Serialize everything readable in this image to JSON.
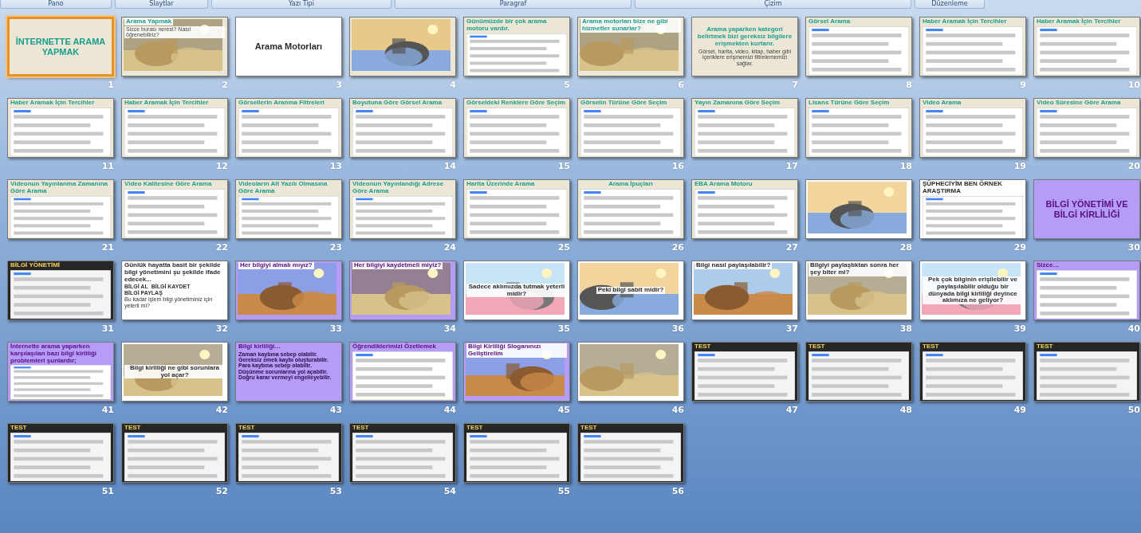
{
  "ribbon_groups": [
    {
      "label": "Pano"
    },
    {
      "label": "Slaytlar"
    },
    {
      "label": "Yazı Tipi"
    },
    {
      "label": "Paragraf"
    },
    {
      "label": "Çizim"
    },
    {
      "label": "Düzenleme"
    }
  ],
  "slides": [
    {
      "number": "1",
      "kind": "beige",
      "centered": true,
      "title": "İNTERNETTE ARAMA YAPMAK",
      "selected": true
    },
    {
      "number": "2",
      "kind": "beige",
      "centered": false,
      "title": "Arama Yapmak",
      "caption": "Sizce burası neresi? Nasıl öğrenebiliriz?",
      "selected": false
    },
    {
      "number": "3",
      "kind": "white",
      "centered": true,
      "title": "Arama Motorları",
      "selected": false
    },
    {
      "number": "4",
      "kind": "beige",
      "selected": false
    },
    {
      "number": "5",
      "kind": "beige",
      "centered": false,
      "title": "Günümüzde bir çok arama motoru vardır.",
      "media": {
        "kind": "panel"
      },
      "selected": false
    },
    {
      "number": "6",
      "kind": "beige",
      "centered": false,
      "title": "Arama motorları bize ne gibi hizmetler sunarlar?",
      "selected": false
    },
    {
      "number": "7",
      "kind": "beige",
      "centered": true,
      "title": "Arama yaparken kategori belirtmek bizi gereksiz bilgilere erişmekten kurtarır.",
      "caption": "Görsel, harita, video, kitap, haber gibi içeriklere erişmemizi filtrelememizi sağlar.",
      "selected": false
    },
    {
      "number": "8",
      "kind": "beige",
      "centered": false,
      "title": "Görsel Arama",
      "media": {
        "kind": "panel"
      },
      "selected": false
    },
    {
      "number": "9",
      "kind": "beige",
      "centered": false,
      "title": "Haber Aramak İçin Tercihler",
      "media": {
        "kind": "panel"
      },
      "selected": false
    },
    {
      "number": "10",
      "kind": "beige",
      "centered": false,
      "title": "Haber Aramak İçin Tercihler",
      "media": {
        "kind": "panel"
      },
      "selected": false
    },
    {
      "number": "11",
      "kind": "beige",
      "centered": false,
      "title": "Haber Aramak İçin Tercihler",
      "media": {
        "kind": "panel"
      },
      "selected": false
    },
    {
      "number": "12",
      "kind": "beige",
      "centered": false,
      "title": "Haber Aramak İçin Tercihler",
      "media": {
        "kind": "panel"
      },
      "selected": false
    },
    {
      "number": "13",
      "kind": "beige",
      "centered": false,
      "title": "Görsellerin Aranma Filtreleri",
      "media": {
        "kind": "panel"
      },
      "selected": false
    },
    {
      "number": "14",
      "kind": "beige",
      "centered": false,
      "title": "Boyutuna Göre Görsel Arama",
      "media": {
        "kind": "panel"
      },
      "selected": false
    },
    {
      "number": "15",
      "kind": "beige",
      "centered": false,
      "title": "Görseldeki Renklere Göre Seçim",
      "media": {
        "kind": "panel"
      },
      "selected": false
    },
    {
      "number": "16",
      "kind": "beige",
      "centered": false,
      "title": "Görselin Türüne Göre Seçim",
      "media": {
        "kind": "panel"
      },
      "selected": false
    },
    {
      "number": "17",
      "kind": "beige",
      "centered": false,
      "title": "Yayın Zamanına Göre Seçim",
      "media": {
        "kind": "panel"
      },
      "selected": false
    },
    {
      "number": "18",
      "kind": "beige",
      "centered": false,
      "title": "Lisans Türüne Göre Seçim",
      "media": {
        "kind": "panel"
      },
      "selected": false
    },
    {
      "number": "19",
      "kind": "beige",
      "centered": false,
      "title": "Video Arama",
      "media": {
        "kind": "panel"
      },
      "selected": false
    },
    {
      "number": "20",
      "kind": "beige",
      "centered": false,
      "title": "Video Süresine Göre Arama",
      "media": {
        "kind": "panel"
      },
      "selected": false
    },
    {
      "number": "21",
      "kind": "beige",
      "centered": false,
      "title": "Videonun Yayınlanma Zamanına Göre Arama",
      "media": {
        "kind": "panel"
      },
      "selected": false
    },
    {
      "number": "22",
      "kind": "beige",
      "centered": false,
      "title": "Video Kalitesine Göre Arama",
      "media": {
        "kind": "panel"
      },
      "selected": false
    },
    {
      "number": "23",
      "kind": "beige",
      "centered": false,
      "title": "Videoların Alt Yazılı Olmasına Göre Arama",
      "media": {
        "kind": "panel"
      },
      "selected": false
    },
    {
      "number": "24",
      "kind": "beige",
      "centered": false,
      "title": "Videonun Yayınlandığı Adrese Göre Arama",
      "media": {
        "kind": "panel"
      },
      "selected": false
    },
    {
      "number": "25",
      "kind": "beige",
      "centered": false,
      "title": "Harita Üzerinde Arama",
      "media": {
        "kind": "panel"
      },
      "selected": false
    },
    {
      "number": "26",
      "kind": "beige",
      "centered": true,
      "title": "Arama İpuçları",
      "media": {
        "kind": "panel"
      },
      "selected": false
    },
    {
      "number": "27",
      "kind": "beige",
      "centered": false,
      "title": "EBA Arama Motoru",
      "media": {
        "kind": "panel"
      },
      "selected": false
    },
    {
      "number": "28",
      "kind": "white",
      "selected": false
    },
    {
      "number": "29",
      "kind": "white",
      "centered": false,
      "title": "ŞÜPHECİYİM BEN ÖRNEK ARAŞTIRMA",
      "media": {
        "kind": "panel"
      },
      "selected": false
    },
    {
      "number": "30",
      "kind": "purple",
      "centered": true,
      "title": "BİLGİ YÖNETİMİ VE BİLGİ KİRLİLİĞİ",
      "selected": false
    },
    {
      "number": "31",
      "kind": "dark",
      "centered": false,
      "title": "BİLGİ YÖNETİMİ",
      "media": {
        "kind": "panel"
      },
      "selected": false
    },
    {
      "number": "32",
      "kind": "white",
      "centered": false,
      "title": "Günlük hayatta basit bir şekilde bilgi yönetimini şu şekilde ifade edecek...",
      "bullets": [
        "BİLGİ AL",
        "BİLGİ KAYDET",
        "BİLGİ PAYLAŞ"
      ],
      "caption": "Bu kadar işlem bilgi yönetiminiz için yeterli mi?",
      "selected": false
    },
    {
      "number": "33",
      "kind": "purple",
      "centered": false,
      "title": "Her bilgiyi almalı mıyız?",
      "selected": false
    },
    {
      "number": "34",
      "kind": "purple",
      "centered": false,
      "title": "Her bilgiyi kaydetmeli miyiz?",
      "selected": false
    },
    {
      "number": "35",
      "kind": "white",
      "centered": true,
      "title": "Sadece aklımızda tutmak yeterli midir?",
      "selected": false
    },
    {
      "number": "36",
      "kind": "white",
      "centered": true,
      "title": "Peki bilgi sabit midir?",
      "selected": false
    },
    {
      "number": "37",
      "kind": "white",
      "centered": false,
      "title": "Bilgi nasıl paylaşılabilir?",
      "selected": false
    },
    {
      "number": "38",
      "kind": "white",
      "centered": false,
      "title": "Bilgiyi paylaştıktan sonra her şey biter mi?",
      "selected": false
    },
    {
      "number": "39",
      "kind": "white",
      "centered": true,
      "title": "Pek çok bilginin erişilebilir ve paylaşılabilir olduğu bir dünyada bilgi kirliliği deyince aklımıza ne geliyor?",
      "selected": false
    },
    {
      "number": "40",
      "kind": "purple",
      "centered": false,
      "title": "Sizce…",
      "media": {
        "kind": "panel"
      },
      "selected": false
    },
    {
      "number": "41",
      "kind": "purple",
      "centered": false,
      "title": "İnternette arama yaparken karşılaşılan bazı bilgi kirliliği problemleri şunlardır;",
      "media": {
        "kind": "panel"
      },
      "selected": false
    },
    {
      "number": "42",
      "kind": "white",
      "centered": true,
      "title": "Bilgi kirliliği ne gibi sorunlara yol açar?",
      "selected": false
    },
    {
      "number": "43",
      "kind": "purple",
      "centered": false,
      "title": "Bilgi kirliliği…",
      "bullets": [
        "Zaman kaybına sebep olabilir.",
        "Gereksiz emek kaybı oluşturabilir.",
        "Para kaybına sebep olabilir.",
        "Düşünme sorunlarına yol açabilir.",
        "Doğru karar vermeyi engelleyebilir."
      ],
      "selected": false
    },
    {
      "number": "44",
      "kind": "purple",
      "centered": false,
      "title": "Öğrendiklerimizi Özetlemek",
      "media": {
        "kind": "panel"
      },
      "selected": false
    },
    {
      "number": "45",
      "kind": "purple",
      "centered": false,
      "title": "Bilgi Kirliliği Sloganınızı Geliştirelim",
      "selected": false
    },
    {
      "number": "46",
      "kind": "white",
      "selected": false
    },
    {
      "number": "47",
      "kind": "dark",
      "centered": false,
      "title": "TEST",
      "media": {
        "kind": "panel"
      },
      "selected": false
    },
    {
      "number": "48",
      "kind": "dark",
      "centered": false,
      "title": "TEST",
      "media": {
        "kind": "panel"
      },
      "selected": false
    },
    {
      "number": "49",
      "kind": "dark",
      "centered": false,
      "title": "TEST",
      "media": {
        "kind": "panel"
      },
      "selected": false
    },
    {
      "number": "50",
      "kind": "dark",
      "centered": false,
      "title": "TEST",
      "media": {
        "kind": "panel"
      },
      "selected": false
    },
    {
      "number": "51",
      "kind": "dark",
      "centered": false,
      "title": "TEST",
      "media": {
        "kind": "panel"
      },
      "selected": false
    },
    {
      "number": "52",
      "kind": "dark",
      "centered": false,
      "title": "TEST",
      "media": {
        "kind": "panel"
      },
      "selected": false
    },
    {
      "number": "53",
      "kind": "dark",
      "centered": false,
      "title": "TEST",
      "media": {
        "kind": "panel"
      },
      "selected": false
    },
    {
      "number": "54",
      "kind": "dark",
      "centered": false,
      "title": "TEST",
      "media": {
        "kind": "panel"
      },
      "selected": false
    },
    {
      "number": "55",
      "kind": "dark",
      "centered": false,
      "title": "TEST",
      "media": {
        "kind": "panel"
      },
      "selected": false
    },
    {
      "number": "56",
      "kind": "dark",
      "centered": false,
      "title": "TEST",
      "media": {
        "kind": "panel"
      },
      "selected": false
    }
  ]
}
